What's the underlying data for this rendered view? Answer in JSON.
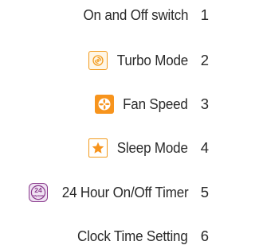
{
  "items": [
    {
      "label": "On and Off switch",
      "number": "1",
      "icon": ""
    },
    {
      "label": "Turbo Mode",
      "number": "2",
      "icon": "turbo-icon"
    },
    {
      "label": "Fan Speed",
      "number": "3",
      "icon": "fan-icon"
    },
    {
      "label": "Sleep Mode",
      "number": "4",
      "icon": "star-icon"
    },
    {
      "label": "24 Hour On/Off Timer",
      "number": "5",
      "icon": "timer-24-icon",
      "icon_text_top": "24",
      "icon_text_bottom": "ON/OFF"
    },
    {
      "label": "Clock Time Setting",
      "number": "6",
      "icon": ""
    }
  ],
  "colors": {
    "text": "#2a2a2a",
    "orange": "#f7941d",
    "purple": "#8a3a8c"
  }
}
